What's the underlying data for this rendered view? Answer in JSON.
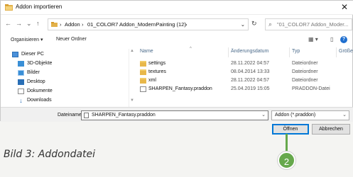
{
  "window": {
    "title": "Addon importieren",
    "close_glyph": "✕"
  },
  "nav": {
    "back": "←",
    "forward": "→",
    "dropdown": "⌄",
    "up": "↑",
    "refresh": "↻"
  },
  "breadcrumb": {
    "sep": "›",
    "items": [
      "Addon",
      "01_COLOR7 Addon_ModernPainting (12)"
    ],
    "dropdown": "⌄"
  },
  "search": {
    "placeholder": "\"01_COLOR7 Addon_Moder..."
  },
  "toolbar": {
    "organize": "Organisieren ▾",
    "new_folder": "Neuer Ordner",
    "view_icon": "▦ ▾",
    "pane_icon": "▯",
    "help": "?"
  },
  "sidebar": {
    "items": [
      {
        "label": "Dieser PC",
        "icon": "pc-icon",
        "color": "#4a90d9"
      },
      {
        "label": "3D-Objekte",
        "icon": "cube-icon",
        "color": "#3a8fd6"
      },
      {
        "label": "Bilder",
        "icon": "pictures-icon",
        "color": "#3a8fd6"
      },
      {
        "label": "Desktop",
        "icon": "desktop-icon",
        "color": "#2a6fb6"
      },
      {
        "label": "Dokumente",
        "icon": "documents-icon",
        "color": "#8a8a8a"
      },
      {
        "label": "Downloads",
        "icon": "download-icon",
        "color": "#2a6fb6"
      }
    ]
  },
  "columns": {
    "name": "Name",
    "date": "Änderungsdatum",
    "type": "Typ",
    "size": "Größe",
    "sort_glyph": "^"
  },
  "files": [
    {
      "name": "settings",
      "date": "28.11.2022 04:57",
      "type": "Dateiordner",
      "kind": "folder"
    },
    {
      "name": "textures",
      "date": "08.04.2014 13:33",
      "type": "Dateiordner",
      "kind": "folder"
    },
    {
      "name": "xml",
      "date": "28.11.2022 04:57",
      "type": "Dateiordner",
      "kind": "folder"
    },
    {
      "name": "SHARPEN_Fantasy.praddon",
      "date": "25.04.2019 15:05",
      "type": "PRADDON-Datei",
      "kind": "file"
    }
  ],
  "footer": {
    "filename_label": "Dateiname:",
    "filename_value": "SHARPEN_Fantasy.praddon",
    "filter_value": "Addon (*.praddon)",
    "dropdown": "⌄",
    "open_label": "Öffnen",
    "cancel_label": "Abbrechen"
  },
  "callout": {
    "number": "2",
    "color": "#66a84c"
  },
  "caption": "Bild 3: Addondatei"
}
